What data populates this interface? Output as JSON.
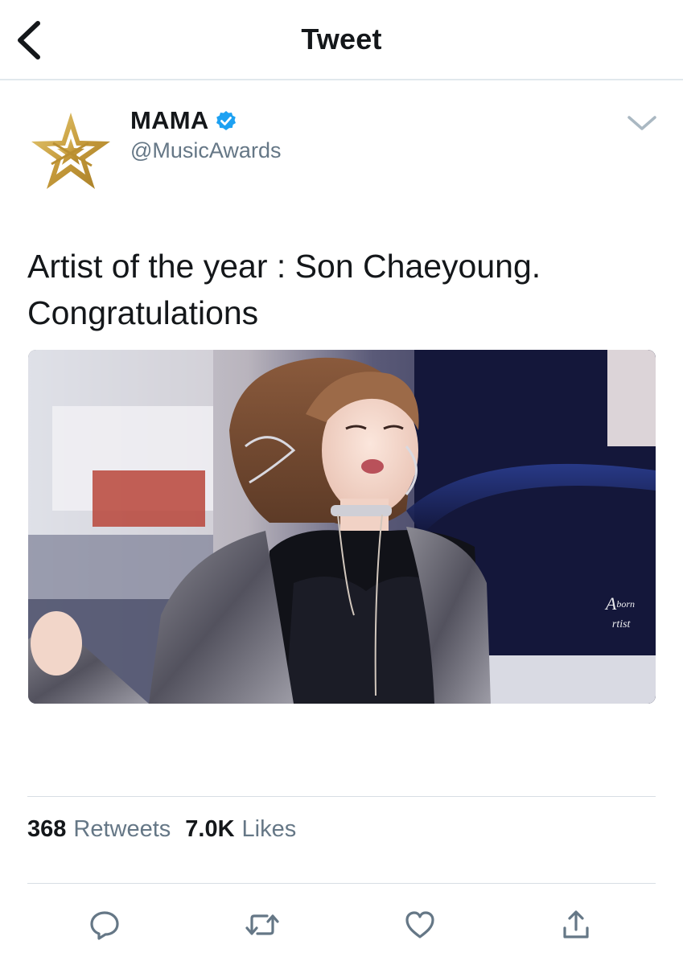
{
  "header": {
    "title": "Tweet",
    "back_icon": "chevron-left-icon"
  },
  "author": {
    "display_name": "MAMA",
    "handle": "@MusicAwards",
    "verified": true,
    "avatar_icon": "gold-star-logo",
    "menu_icon": "chevron-down-icon"
  },
  "tweet": {
    "line1": "Artist of the year : Son Chaeyoung.",
    "line2": "Congratulations"
  },
  "media": {
    "watermark_line1": "A",
    "watermark_line2": "born",
    "watermark_line3": "rtist"
  },
  "stats": {
    "retweets_count": "368",
    "retweets_label": "Retweets",
    "likes_count": "7.0K",
    "likes_label": "Likes"
  },
  "actions": [
    {
      "name": "reply",
      "icon": "reply-icon"
    },
    {
      "name": "retweet",
      "icon": "retweet-icon"
    },
    {
      "name": "like",
      "icon": "heart-icon"
    },
    {
      "name": "share",
      "icon": "share-icon"
    }
  ],
  "colors": {
    "text": "#14171a",
    "secondary_text": "#657786",
    "verified_blue": "#1da1f2",
    "icon_gray": "#657786",
    "divider": "#e1e8ed",
    "avatar_gold": "#c9a84c"
  }
}
